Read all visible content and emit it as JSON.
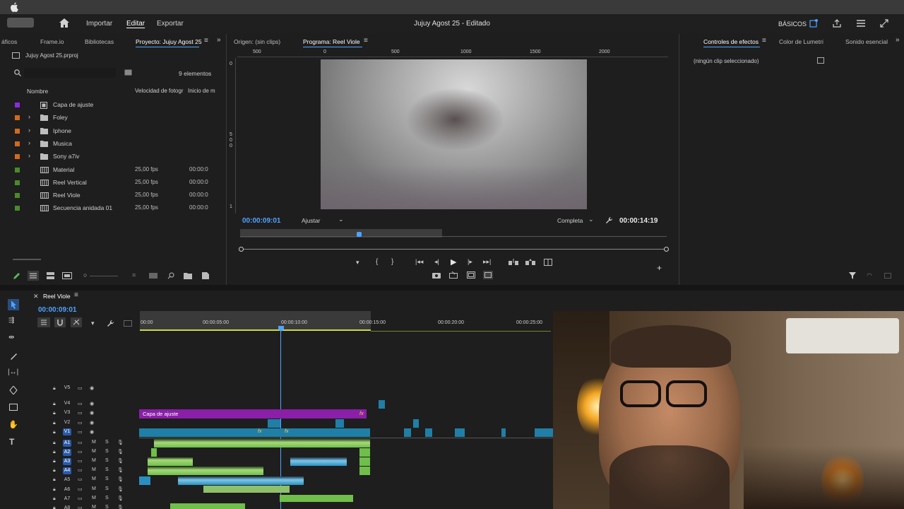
{
  "header": {
    "nav": [
      "Importar",
      "Editar",
      "Exportar"
    ],
    "active_nav": "Editar",
    "title": "Jujuy Agost 25 - Editado",
    "workspace": "BÁSICOS"
  },
  "left_panel": {
    "tabs": [
      "áficos",
      "Frame.io",
      "Bibliotecas",
      "Proyecto: Jujuy Agost 25"
    ],
    "project_file": "Jujuy Agost 25.prproj",
    "item_count": "9 elementos",
    "columns": [
      "Nombre",
      "Velocidad de fotogr",
      "Inicio de m"
    ],
    "items": [
      {
        "name": "Capa de ajuste",
        "fps": "",
        "start": "",
        "color": "#8a2be2",
        "type": "adjust"
      },
      {
        "name": "Foley",
        "fps": "",
        "start": "",
        "color": "#d2691e",
        "type": "folder"
      },
      {
        "name": "Iphone",
        "fps": "",
        "start": "",
        "color": "#d2691e",
        "type": "folder"
      },
      {
        "name": "Musica",
        "fps": "",
        "start": "",
        "color": "#d2691e",
        "type": "folder"
      },
      {
        "name": "Sony a7iv",
        "fps": "",
        "start": "",
        "color": "#d2691e",
        "type": "folder"
      },
      {
        "name": "Material",
        "fps": "25,00 fps",
        "start": "00:00:0",
        "color": "#4a8a2a",
        "type": "seq"
      },
      {
        "name": "Reel Vertical",
        "fps": "25,00 fps",
        "start": "00:00:0",
        "color": "#4a8a2a",
        "type": "seq"
      },
      {
        "name": "Reel Viole",
        "fps": "25,00 fps",
        "start": "00:00:0",
        "color": "#4a8a2a",
        "type": "seq"
      },
      {
        "name": "Secuencia anidada 01",
        "fps": "25,00 fps",
        "start": "00:00:0",
        "color": "#4a8a2a",
        "type": "seq"
      }
    ]
  },
  "monitor": {
    "tabs": [
      "Origen: (sin clips)",
      "Programa: Reel Viole"
    ],
    "ruler": [
      "500",
      "0",
      "500",
      "1000",
      "1500",
      "2000"
    ],
    "vruler": [
      "0",
      "5",
      "0",
      "0",
      "1"
    ],
    "timecode": "00:00:09:01",
    "fit": "Ajustar",
    "quality": "Completa",
    "duration": "00:00:14:19",
    "playhead_fraction": 0.51
  },
  "effects": {
    "tabs": [
      "Controles de efectos",
      "Color de Lumetri",
      "Sonido esencial"
    ],
    "message": "(ningún clip seleccionado)"
  },
  "timeline": {
    "sequence": "Reel Viole",
    "timecode": "00:00:09:01",
    "ruler": [
      "00:00",
      "00:00:05:00",
      "00:00:10:00",
      "00:00:15:00",
      "00:00:20:00",
      "00:00:25:00"
    ],
    "video_tracks": [
      "V5",
      "V4",
      "V3",
      "V2",
      "V1"
    ],
    "audio_tracks": [
      "A1",
      "A2",
      "A3",
      "A4",
      "A5",
      "A6",
      "A7",
      "A8"
    ],
    "adjust_clip": "Capa de ajuste",
    "fx_badge": "fx",
    "mute": "M",
    "solo": "S"
  }
}
